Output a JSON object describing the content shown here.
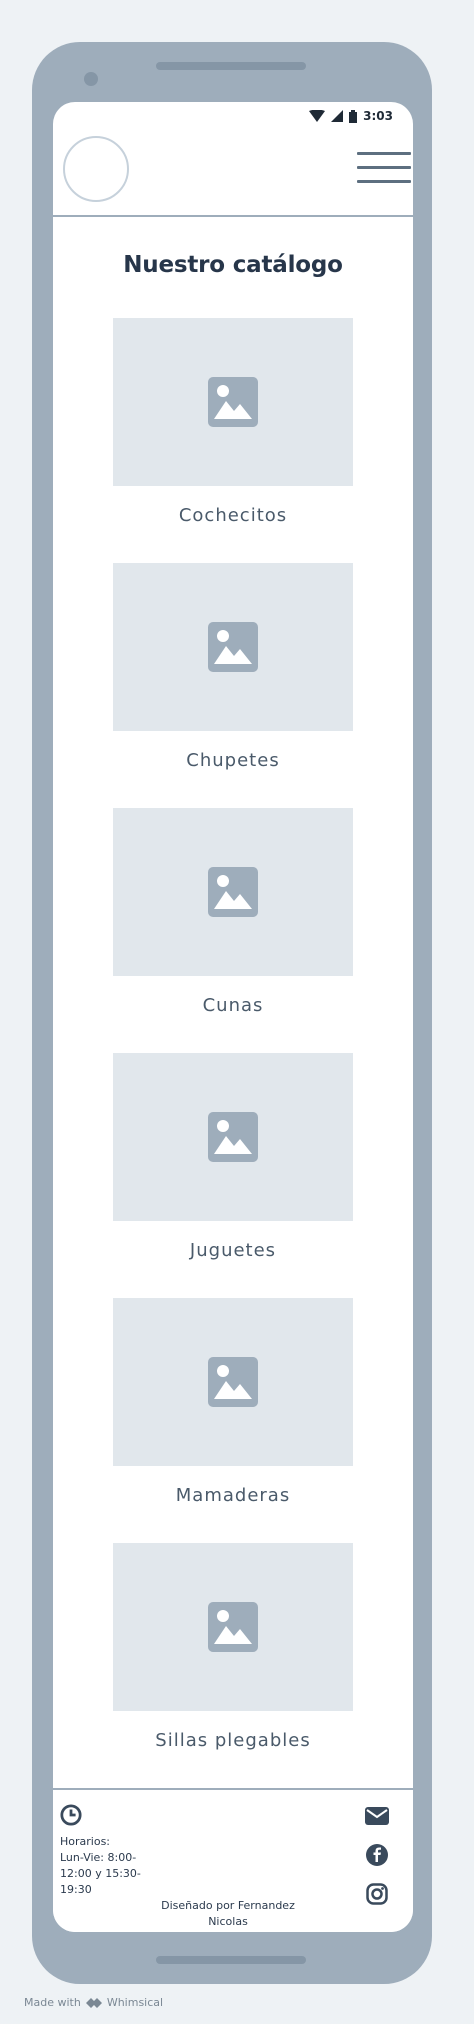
{
  "status": {
    "time": "3:03"
  },
  "page": {
    "title": "Nuestro catálogo"
  },
  "catalog": [
    {
      "label": "Cochecitos",
      "icon": "image-placeholder-icon"
    },
    {
      "label": "Chupetes",
      "icon": "image-placeholder-icon"
    },
    {
      "label": "Cunas",
      "icon": "image-placeholder-icon"
    },
    {
      "label": "Juguetes",
      "icon": "image-placeholder-icon"
    },
    {
      "label": "Mamaderas",
      "icon": "image-placeholder-icon"
    },
    {
      "label": "Sillas plegables",
      "icon": "image-placeholder-icon"
    }
  ],
  "footer": {
    "hours_text": "Horarios:\nLun-Vie: 8:00-\n12:00 y 15:30-\n19:30",
    "credit": "Diseñado por Fernandez\nNicolas",
    "social": [
      "mail-icon",
      "facebook-icon",
      "instagram-icon"
    ]
  },
  "watermark": {
    "text": "Made with",
    "brand": "Whimsical"
  },
  "colors": {
    "frame": "#9eadbb",
    "placeholder": "#e1e7ec",
    "placeholder_icon": "#9eadbb",
    "title": "#27364a"
  }
}
